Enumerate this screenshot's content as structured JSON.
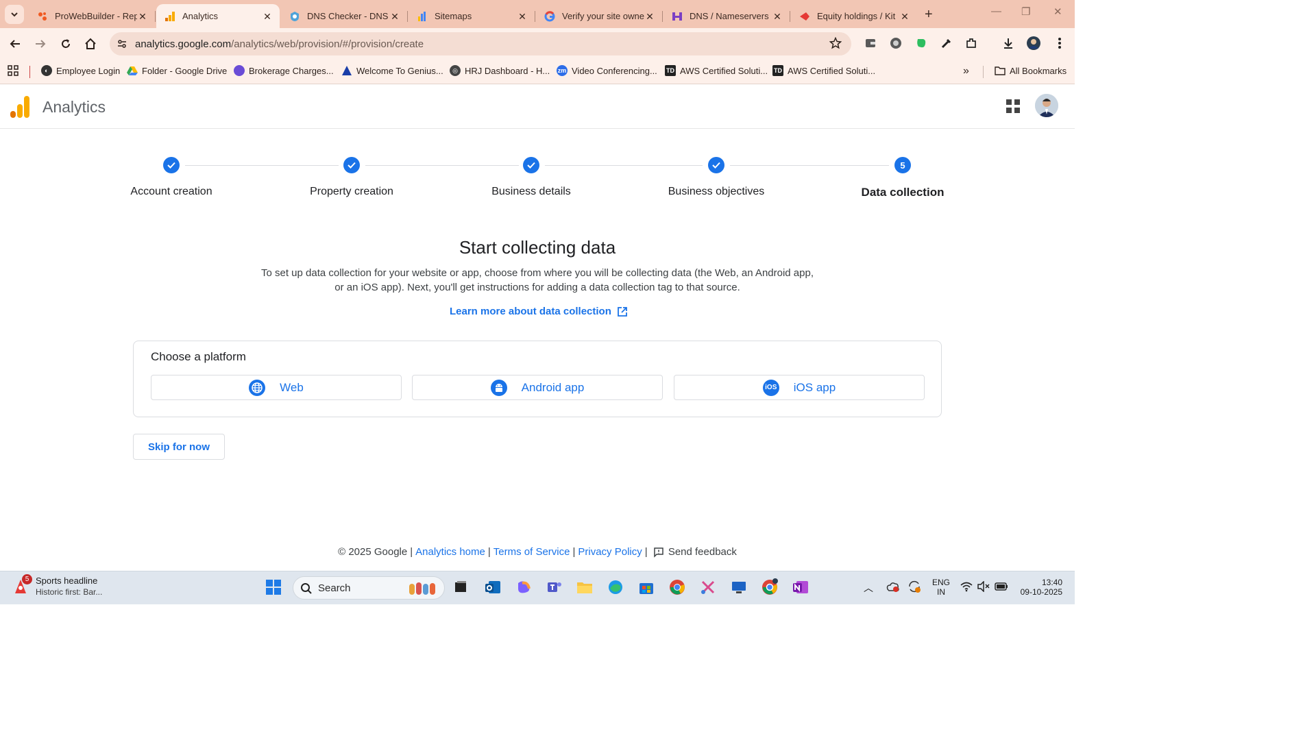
{
  "browser": {
    "tabs": [
      {
        "title": "ProWebBuilder - Rep",
        "favicon": "prowebbuilder-icon",
        "active": false
      },
      {
        "title": "Analytics",
        "favicon": "analytics-icon",
        "active": true
      },
      {
        "title": "DNS Checker - DNS C",
        "favicon": "dnschecker-icon",
        "active": false
      },
      {
        "title": "Sitemaps",
        "favicon": "sitemaps-icon",
        "active": false
      },
      {
        "title": "Verify your site owne",
        "favicon": "google-icon",
        "active": false
      },
      {
        "title": "DNS / Nameservers |",
        "favicon": "nameservers-icon",
        "active": false
      },
      {
        "title": "Equity holdings / Kit",
        "favicon": "kite-icon",
        "active": false
      }
    ],
    "url_host": "analytics.google.com",
    "url_path": "/analytics/web/provision/#/provision/create",
    "bookmarks": [
      {
        "label": "Employee Login",
        "icon": "globe-icon"
      },
      {
        "label": "Folder - Google Drive",
        "icon": "drive-icon"
      },
      {
        "label": "Brokerage Charges...",
        "icon": "brokerage-icon"
      },
      {
        "label": "Welcome To Genius...",
        "icon": "genius-icon"
      },
      {
        "label": "HRJ Dashboard - H...",
        "icon": "hrj-icon"
      },
      {
        "label": "Video Conferencing...",
        "icon": "zoom-icon"
      },
      {
        "label": "AWS Certified Soluti...",
        "icon": "td-icon"
      },
      {
        "label": "AWS Certified Soluti...",
        "icon": "td-icon"
      }
    ],
    "all_bookmarks": "All Bookmarks"
  },
  "ga": {
    "app_title": "Analytics",
    "steps": [
      {
        "label": "Account creation",
        "state": "done"
      },
      {
        "label": "Property creation",
        "state": "done"
      },
      {
        "label": "Business details",
        "state": "done"
      },
      {
        "label": "Business objectives",
        "state": "done"
      },
      {
        "label": "Data collection",
        "state": "current",
        "number": "5"
      }
    ],
    "heading": "Start collecting data",
    "description": "To set up data collection for your website or app, choose from where you will be collecting data (the Web, an Android app, or an iOS app). Next, you'll get instructions for adding a data collection tag to that source.",
    "learn_more": "Learn more about data collection",
    "platform_card_title": "Choose a platform",
    "platforms": [
      {
        "label": "Web",
        "icon": "globe-icon"
      },
      {
        "label": "Android app",
        "icon": "android-icon"
      },
      {
        "label": "iOS app",
        "icon": "ios-icon",
        "icon_text": "iOS"
      }
    ],
    "skip": "Skip for now",
    "footer": {
      "copyright": "© 2025 Google",
      "analytics_home": "Analytics home",
      "terms": "Terms of Service",
      "privacy": "Privacy Policy",
      "feedback": "Send feedback"
    },
    "accent": "#1a73e8"
  },
  "taskbar": {
    "news_badge": "5",
    "news_title": "Sports headline",
    "news_sub": "Historic first: Bar...",
    "search_placeholder": "Search",
    "lang": "ENG",
    "region": "IN",
    "time": "13:40",
    "date": "09-10-2025"
  }
}
